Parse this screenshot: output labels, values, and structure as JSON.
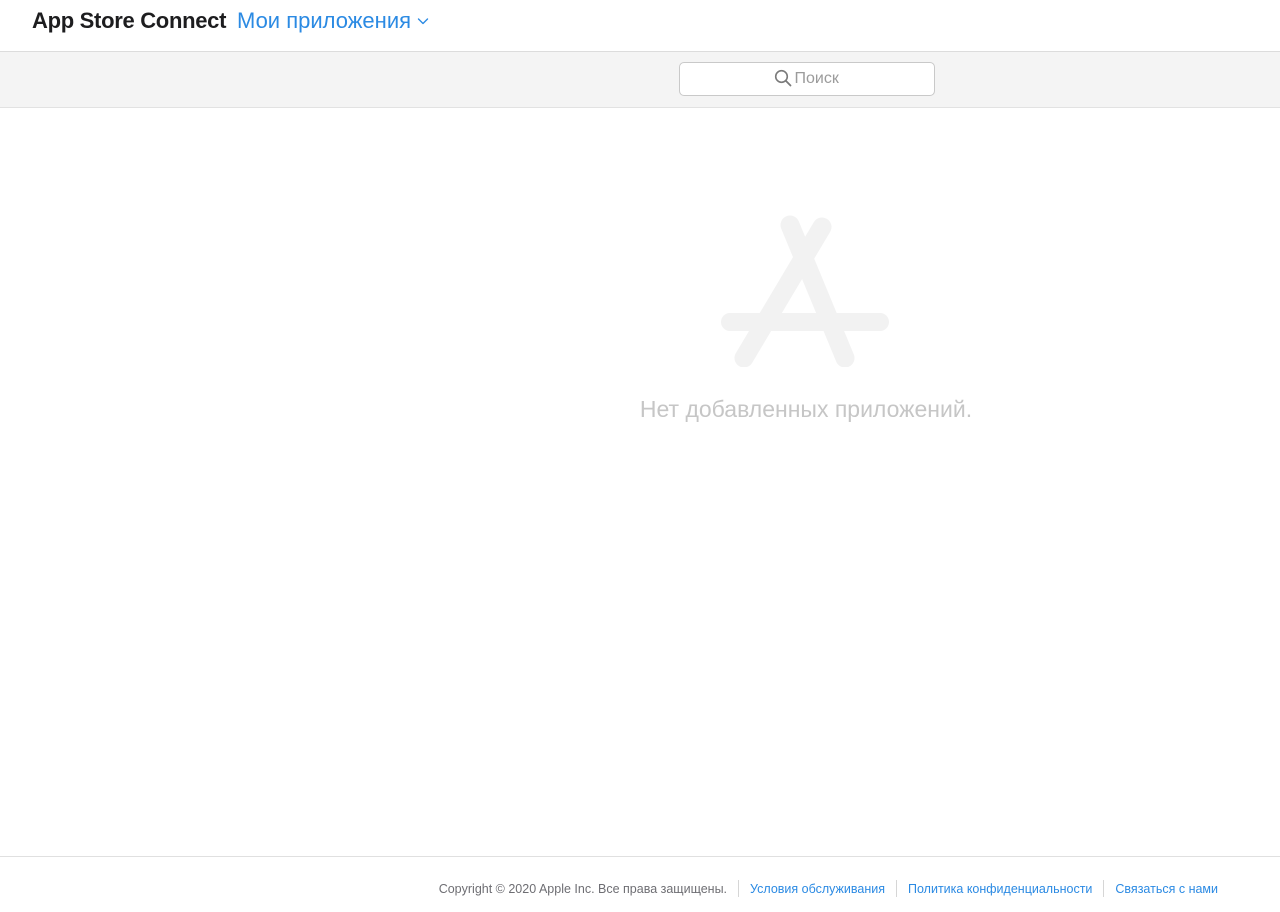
{
  "header": {
    "brand": "App Store Connect",
    "menu_label": "Мои приложения",
    "menu_icon": "chevron-down-icon"
  },
  "search": {
    "placeholder": "Поиск",
    "value": "",
    "icon": "search-icon"
  },
  "empty_state": {
    "icon": "app-store-logo-icon",
    "message": "Нет добавленных приложений."
  },
  "footer": {
    "copyright": "Copyright © 2020 Apple Inc. Все права защищены.",
    "links": [
      "Условия обслуживания",
      "Политика конфиденциальности",
      "Связаться с нами"
    ]
  },
  "colors": {
    "accent": "#2b8ae3",
    "toolbar_bg": "#f4f4f4",
    "muted_text": "#c6c6c6",
    "logo": "#f2f2f2"
  }
}
